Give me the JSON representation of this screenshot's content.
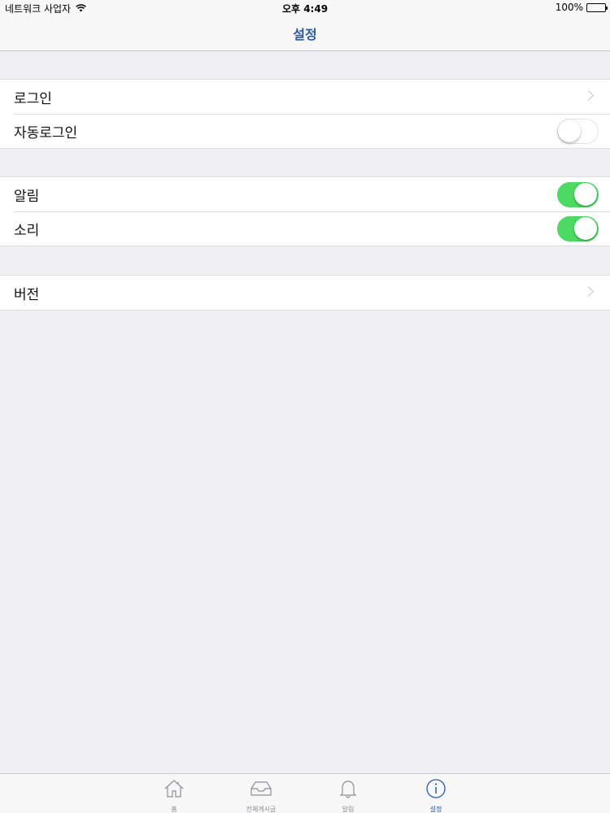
{
  "status_bar": {
    "carrier": "네트워크 사업자",
    "time": "오후 4:49",
    "battery": "100%"
  },
  "nav": {
    "title": "설정"
  },
  "sections": [
    {
      "rows": [
        {
          "label": "로그인",
          "accessory": "chevron"
        },
        {
          "label": "자동로그인",
          "accessory": "toggle",
          "on": false
        }
      ]
    },
    {
      "rows": [
        {
          "label": "알림",
          "accessory": "toggle",
          "on": true
        },
        {
          "label": "소리",
          "accessory": "toggle",
          "on": true
        }
      ]
    },
    {
      "rows": [
        {
          "label": "버전",
          "accessory": "chevron"
        }
      ]
    }
  ],
  "tabbar": {
    "tabs": [
      {
        "label": "홈",
        "icon": "home-icon",
        "active": false
      },
      {
        "label": "전체게시글",
        "icon": "inbox-icon",
        "active": false
      },
      {
        "label": "알림",
        "icon": "bell-icon",
        "active": false
      },
      {
        "label": "설정",
        "icon": "info-icon",
        "active": true
      }
    ]
  },
  "colors": {
    "accent": "#2a5a9e",
    "toggle_on": "#4cd964",
    "background": "#efeff4",
    "tab_inactive": "#8e8e93"
  }
}
